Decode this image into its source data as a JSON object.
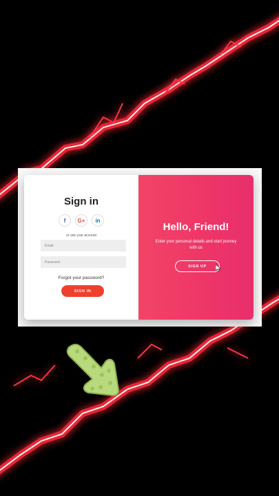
{
  "signin_panel": {
    "title": "Sign in",
    "socials": [
      {
        "icon": "facebook-icon",
        "glyph": "f",
        "color": "#3b5998"
      },
      {
        "icon": "google-plus-icon",
        "glyph": "G+",
        "color": "#dd4b39"
      },
      {
        "icon": "linkedin-icon",
        "glyph": "in",
        "color": "#0077b5"
      }
    ],
    "alt_text": "or use your account",
    "email_placeholder": "Email",
    "password_placeholder": "Password",
    "forgot_link": "Forgot your password?",
    "signin_button": "SIGN IN"
  },
  "welcome_panel": {
    "title": "Hello, Friend!",
    "description": "Enter your personal details and start journey with us",
    "signup_button": "SIGN UP"
  },
  "colors": {
    "accent": "#f0402c",
    "overlay": "#ee3567",
    "background": "#000000"
  }
}
